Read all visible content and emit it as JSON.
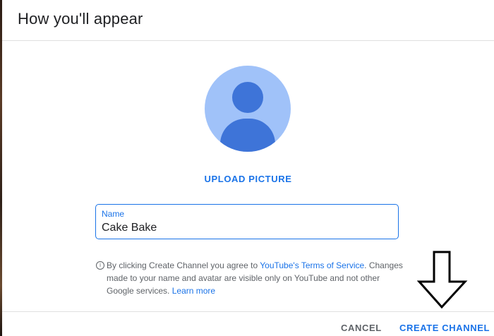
{
  "dialog": {
    "title": "How you'll appear",
    "upload_label": "UPLOAD PICTURE",
    "name_field": {
      "label": "Name",
      "value": "Cake Bake"
    },
    "info": {
      "icon": "info-icon",
      "text_before": "By clicking Create Channel you agree to ",
      "tos_link": "YouTube's Terms of Service",
      "text_after": ". Changes made to your name and avatar are visible only on YouTube and not other Google services. ",
      "learn_more": "Learn more"
    },
    "buttons": {
      "cancel": "CANCEL",
      "create": "CREATE CHANNEL"
    }
  },
  "colors": {
    "accent": "#1a73e8",
    "avatar_bg": "#a0c2f9",
    "avatar_fg": "#3e74d8"
  }
}
